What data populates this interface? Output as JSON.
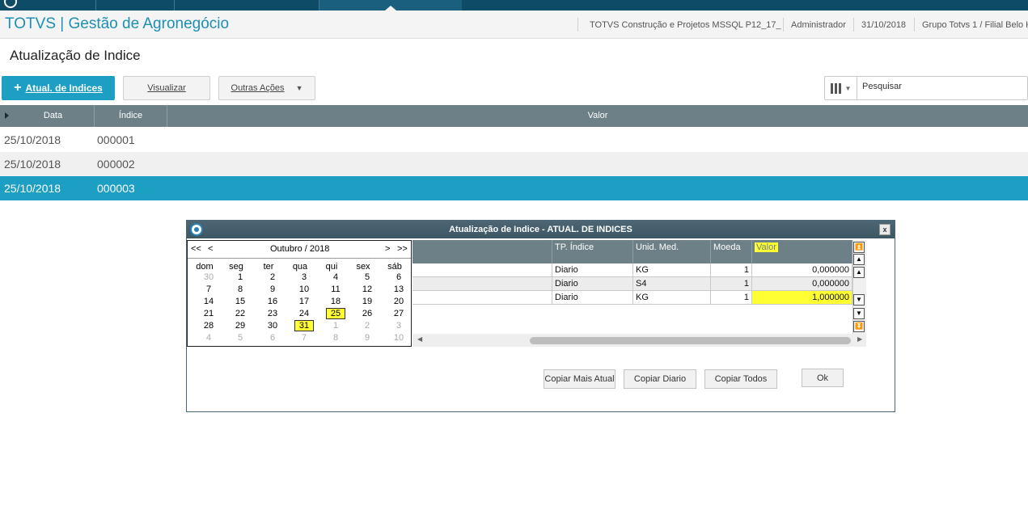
{
  "header": {
    "app_title": "TOTVS | Gestão de Agronegócio",
    "environment": "TOTVS Construção e Projetos MSSQL P12_17_",
    "user": "Administrador",
    "date": "31/10/2018",
    "branch": "Grupo Totvs 1 / Filial Belo H"
  },
  "page": {
    "title": "Atualização de Indice"
  },
  "toolbar": {
    "primary_label": "Atual. de Indices",
    "view_label": "Visualizar",
    "other_label": "Outras Ações",
    "search_placeholder": "Pesquisar"
  },
  "grid": {
    "columns": [
      "Data",
      "Índice",
      "Valor"
    ],
    "rows": [
      {
        "data": "25/10/2018",
        "indice": "000001"
      },
      {
        "data": "25/10/2018",
        "indice": "000002"
      },
      {
        "data": "25/10/2018",
        "indice": "000003"
      }
    ]
  },
  "modal": {
    "title": "Atualização de Indice - ATUAL. DE INDICES",
    "close_label": "x",
    "columns": [
      "TP. Índice",
      "Unid. Med.",
      "Moeda",
      "Valor"
    ],
    "rows": [
      {
        "tp": "Diario",
        "unid": "KG",
        "moeda": "1",
        "valor": "0,000000"
      },
      {
        "tp": "Diario",
        "unid": "S4",
        "moeda": "1",
        "valor": "0,000000"
      },
      {
        "tp": "Diario",
        "unid": "KG",
        "moeda": "1",
        "valor": "1,000000"
      }
    ],
    "buttons": {
      "copy_latest": "Copiar Mais Atual",
      "copy_daily": "Copiar Diario",
      "copy_all": "Copiar Todos",
      "ok": "Ok"
    }
  },
  "calendar": {
    "prev_year": "<<",
    "prev_month": "<",
    "month_label": "Outubro / 2018",
    "next_month": ">",
    "next_year": ">>",
    "weekdays": [
      "dom",
      "seg",
      "ter",
      "qua",
      "qui",
      "sex",
      "sáb"
    ],
    "weeks": [
      [
        "30",
        "1",
        "2",
        "3",
        "4",
        "5",
        "6"
      ],
      [
        "7",
        "8",
        "9",
        "10",
        "11",
        "12",
        "13"
      ],
      [
        "14",
        "15",
        "16",
        "17",
        "18",
        "19",
        "20"
      ],
      [
        "21",
        "22",
        "23",
        "24",
        "25",
        "26",
        "27"
      ],
      [
        "28",
        "29",
        "30",
        "31",
        "1",
        "2",
        "3"
      ],
      [
        "4",
        "5",
        "6",
        "7",
        "8",
        "9",
        "10"
      ]
    ],
    "marked_days": [
      "25",
      "31"
    ]
  },
  "colors": {
    "accent": "#1d9ec3",
    "header_text": "#1d8fb4",
    "grid_header": "#6d7f87",
    "highlight": "#ffff33",
    "top_strip": "#0e4b66"
  }
}
